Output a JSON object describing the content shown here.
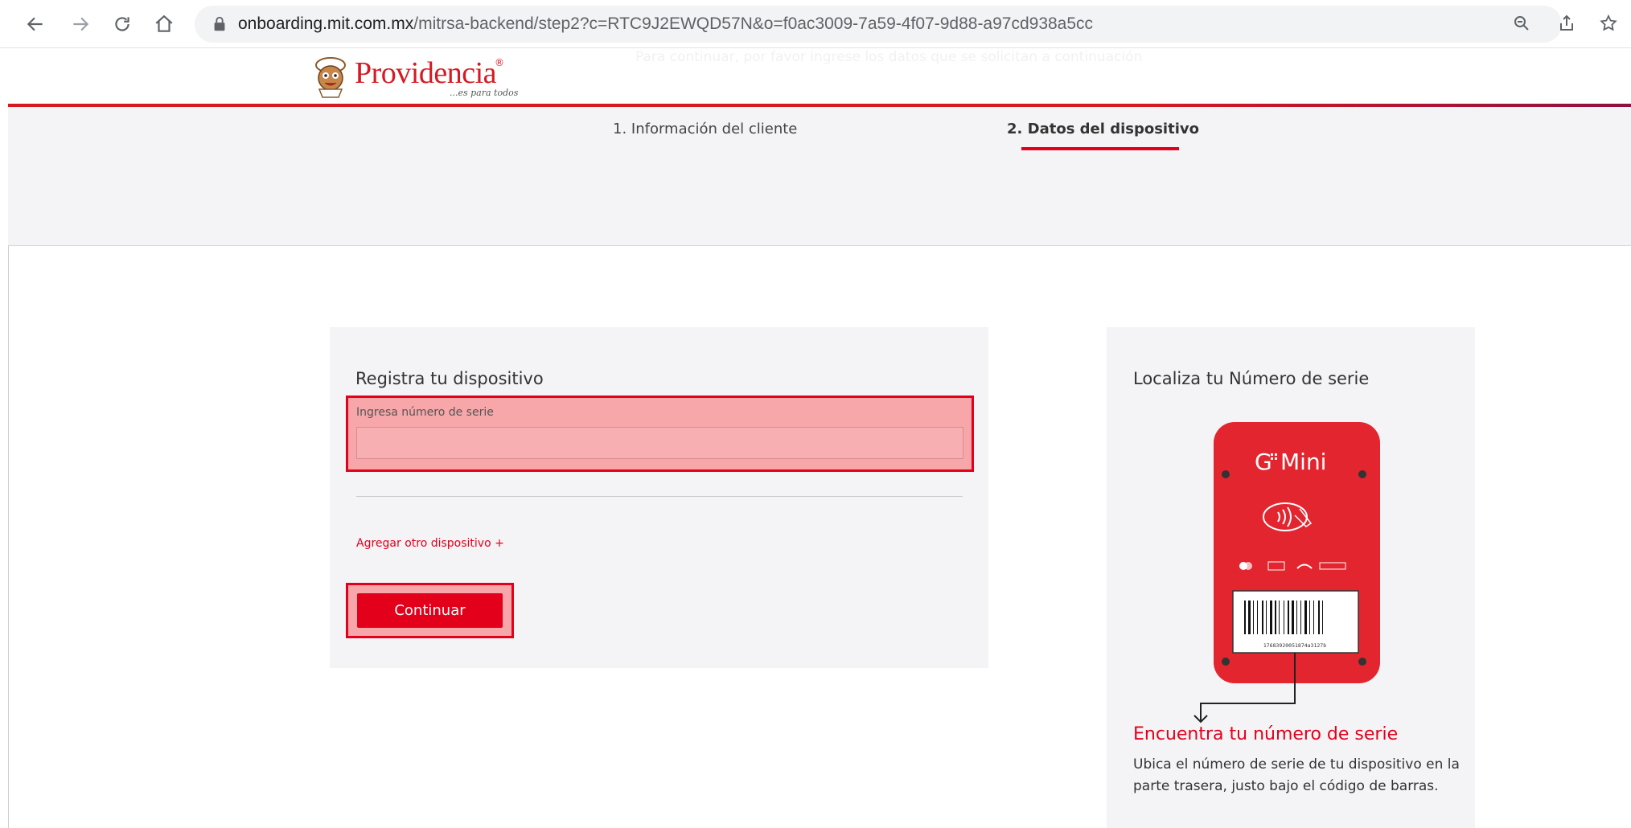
{
  "browser": {
    "url_host": "onboarding.mit.com.mx",
    "url_path": "/mitrsa-backend/step2?c=RTC9J2EWQD57N&o=f0ac3009-7a59-4f07-9d88-a97cd938a5cc",
    "icons": [
      "back-arrow-icon",
      "forward-arrow-icon",
      "reload-icon",
      "home-icon",
      "lock-icon",
      "zoom-icon",
      "share-icon",
      "bookmark-star-icon"
    ]
  },
  "header": {
    "faint_text": "Para continuar, por favor ingrese los datos que se solicitan a continuación",
    "logo_text": "Providencia",
    "logo_reg": "®",
    "logo_tagline": "...es para todos"
  },
  "steps": [
    {
      "label": "1. Información del cliente",
      "active": false
    },
    {
      "label": "2. Datos del dispositivo",
      "active": true
    }
  ],
  "register": {
    "title": "Registra tu dispositivo",
    "serial_label": "Ingresa número de serie",
    "serial_value": "",
    "add_device_link": "Agregar otro dispositivo +",
    "continue_button": "Continuar"
  },
  "locate": {
    "title": "Localiza tu Número de serie",
    "device_brand_g": "G",
    "device_brand_mini": "Mini",
    "barcode_number": "17683920051874a3127b",
    "find_title": "Encuentra tu número de serie",
    "find_description": "Ubica el número de serie de tu dispositivo en la parte trasera, justo bajo el código de barras."
  },
  "colors": {
    "brand_red": "#e3001b",
    "highlight_fill": "#f7a6a9",
    "panel_bg": "#f4f4f6"
  }
}
